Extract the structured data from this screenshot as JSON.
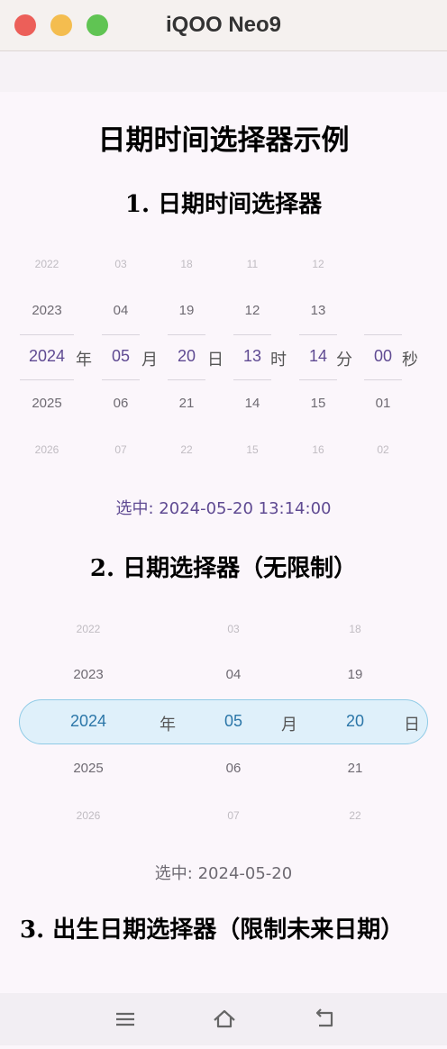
{
  "window": {
    "title": "iQOO Neo9"
  },
  "page": {
    "title": "日期时间选择器示例"
  },
  "section1": {
    "title": "1. 日期时间选择器",
    "columns": [
      {
        "values": [
          "2022",
          "2023",
          "2024",
          "2025",
          "2026"
        ],
        "unit": "年"
      },
      {
        "values": [
          "03",
          "04",
          "05",
          "06",
          "07"
        ],
        "unit": "月"
      },
      {
        "values": [
          "18",
          "19",
          "20",
          "21",
          "22"
        ],
        "unit": "日"
      },
      {
        "values": [
          "11",
          "12",
          "13",
          "14",
          "15"
        ],
        "unit": "时"
      },
      {
        "values": [
          "12",
          "13",
          "14",
          "15",
          "16"
        ],
        "unit": "分"
      },
      {
        "values": [
          "",
          "",
          "00",
          "01",
          "02"
        ],
        "unit": "秒"
      }
    ],
    "selected_text": "选中: 2024-05-20 13:14:00",
    "selected_color": "#5f4a92"
  },
  "section2": {
    "title": "2. 日期选择器（无限制）",
    "columns": [
      {
        "values": [
          "2022",
          "2023",
          "2024",
          "2025",
          "2026"
        ],
        "unit": "年"
      },
      {
        "values": [
          "03",
          "04",
          "05",
          "06",
          "07"
        ],
        "unit": "月"
      },
      {
        "values": [
          "18",
          "19",
          "20",
          "21",
          "22"
        ],
        "unit": "日"
      }
    ],
    "selected_text": "选中: 2024-05-20",
    "selected_color": "#6e6a72",
    "highlight_color": "#dff0fa"
  },
  "section3": {
    "title": "3. 出生日期选择器（限制未来日期）"
  },
  "navbar": {
    "icons": [
      "menu-icon",
      "home-icon",
      "back-icon"
    ]
  }
}
